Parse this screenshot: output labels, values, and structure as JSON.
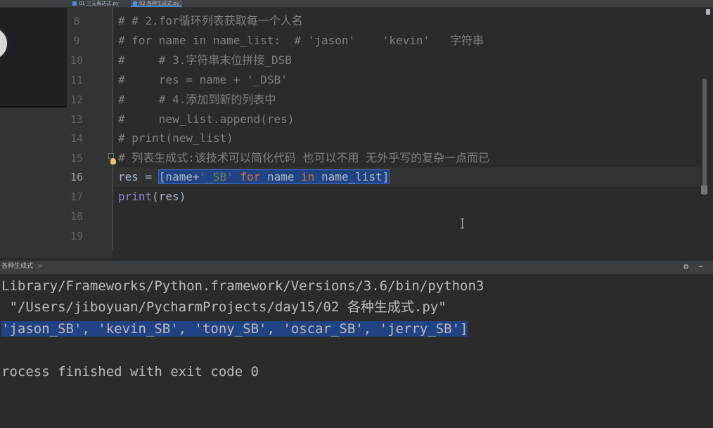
{
  "tabs": [
    {
      "label": "01 三元表达式.py",
      "active": false
    },
    {
      "label": "02 各种生成式.py",
      "active": true
    }
  ],
  "editor": {
    "lines": [
      {
        "num": "8",
        "text": "# # 2.for循环列表获取每一个人名"
      },
      {
        "num": "9",
        "text": "# for name in name_list:  # 'jason'    'kevin'   字符串"
      },
      {
        "num": "10",
        "text": "#     # 3.字符串末位拼接_DSB"
      },
      {
        "num": "11",
        "text": "#     res = name + '_DSB'"
      },
      {
        "num": "12",
        "text": "#     # 4.添加到新的列表中"
      },
      {
        "num": "13",
        "text": "#     new_list.append(res)"
      },
      {
        "num": "14",
        "text": "# print(new_list)"
      },
      {
        "num": "15",
        "text": "# 列表生成式:该技术可以简化代码 也可以不用 无外乎写的复杂一点而已"
      },
      {
        "num": "16"
      },
      {
        "num": "17"
      },
      {
        "num": "18",
        "text": ""
      },
      {
        "num": "19",
        "text": ""
      }
    ],
    "line16": {
      "prefix": "res = ",
      "open": "[name+",
      "str": "'_SB'",
      "sp1": " ",
      "kw_for": "for",
      "mid": " name ",
      "kw_in": "in",
      "end": " name_list]"
    },
    "line17": {
      "func": "print",
      "args": "(res)"
    }
  },
  "run_panel": {
    "tab_label": "各种生成式",
    "close": "×",
    "gear": "⚙",
    "minimize": "−",
    "output": [
      "Library/Frameworks/Python.framework/Versions/3.6/bin/python3",
      " \"/Users/jiboyuan/PycharmProjects/day15/02 各种生成式.py\"",
      "'jason_SB', 'kevin_SB', 'tony_SB', 'oscar_SB', 'jerry_SB']",
      "",
      "rocess finished with exit code 0"
    ]
  }
}
